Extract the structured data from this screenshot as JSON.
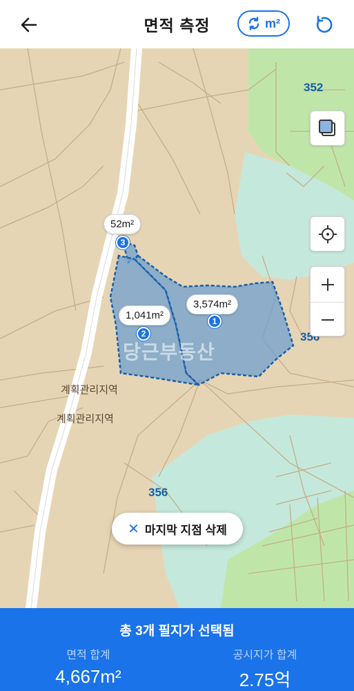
{
  "header": {
    "title": "면적 측정",
    "unit_label": "m²",
    "back_icon": "arrow-left-icon",
    "reset_icon": "refresh-icon"
  },
  "map": {
    "parcel_labels": [
      "352",
      "356",
      "356"
    ],
    "zone_labels": [
      "계획관리지역",
      "계획관리지역"
    ],
    "area_tags": [
      "52m²",
      "1,041m²",
      "3,574m²"
    ],
    "markers": [
      "3",
      "2",
      "1"
    ],
    "watermark": "당근부동산",
    "controls": {
      "layers_icon": "layers-icon",
      "location_icon": "crosshair-icon",
      "zoom_in": "+",
      "zoom_out": "−"
    }
  },
  "delete_button": {
    "label": "마지막 지점 삭제"
  },
  "summary": {
    "headline": "총 3개 필지가 선택됨",
    "area_label": "면적 합계",
    "area_value": "4,667m²",
    "price_label": "공시지가 합계",
    "price_value": "2.75억"
  },
  "colors": {
    "accent": "#1a73e8",
    "map_tan": "#e6d5b5",
    "map_green": "#bfe6a8",
    "map_mint": "#c5e8dc",
    "selection_fill": "#6f9fcf"
  }
}
